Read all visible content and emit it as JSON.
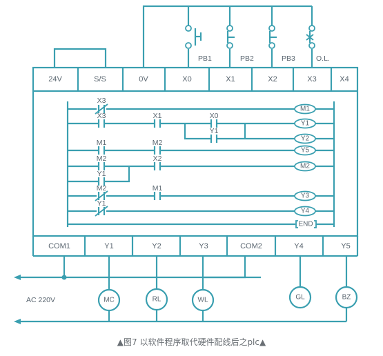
{
  "colors": {
    "line": "#3a9fb0",
    "text": "#5a6670",
    "caption": "#6a6f74"
  },
  "inputs": {
    "switches": [
      {
        "label": "PB1",
        "type": "normally-open"
      },
      {
        "label": "PB2",
        "type": "normally-closed"
      },
      {
        "label": "PB3",
        "type": "normally-closed"
      },
      {
        "label": "O.L.",
        "type": "overload-normally-closed"
      }
    ],
    "terminals": [
      "24V",
      "S/S",
      "0V",
      "X0",
      "X1",
      "X2",
      "X3",
      "X4"
    ]
  },
  "ladder": {
    "rungs": [
      {
        "contacts": [
          {
            "label": "X3",
            "type": "NC"
          }
        ],
        "coil": "M1"
      },
      {
        "contacts": [
          {
            "label": "X3",
            "type": "NO"
          },
          {
            "label": "X1",
            "type": "NO"
          },
          {
            "label": "X0",
            "type": "NO"
          }
        ],
        "coil": "Y1"
      },
      {
        "contacts": [
          {
            "label": "Y1",
            "type": "NO",
            "branch": true
          }
        ],
        "coil": "Y2"
      },
      {
        "contacts": [
          {
            "label": "M1",
            "type": "NO"
          },
          {
            "label": "M2",
            "type": "NO"
          }
        ],
        "coil": "Y5"
      },
      {
        "contacts": [
          {
            "label": "M2",
            "type": "NO"
          },
          {
            "label": "X2",
            "type": "NO"
          }
        ],
        "coil": "M2"
      },
      {
        "contacts": [
          {
            "label": "Y1",
            "type": "NO",
            "branch": true
          }
        ],
        "coil": ""
      },
      {
        "contacts": [
          {
            "label": "M2",
            "type": "NC"
          },
          {
            "label": "M1",
            "type": "NO"
          }
        ],
        "coil": "Y3"
      },
      {
        "contacts": [
          {
            "label": "Y1",
            "type": "NC"
          }
        ],
        "coil": "Y4"
      },
      {
        "contacts": [],
        "coil": "END",
        "instruction": true
      }
    ]
  },
  "outputs": {
    "terminals": [
      "COM1",
      "Y1",
      "Y2",
      "Y3",
      "COM2",
      "Y4",
      "Y5"
    ],
    "loads": [
      "MC",
      "RL",
      "WL",
      "GL",
      "BZ"
    ],
    "supply_label": "AC 220V"
  },
  "caption": "▲图7 以软件程序取代硬件配线后之plc▲"
}
